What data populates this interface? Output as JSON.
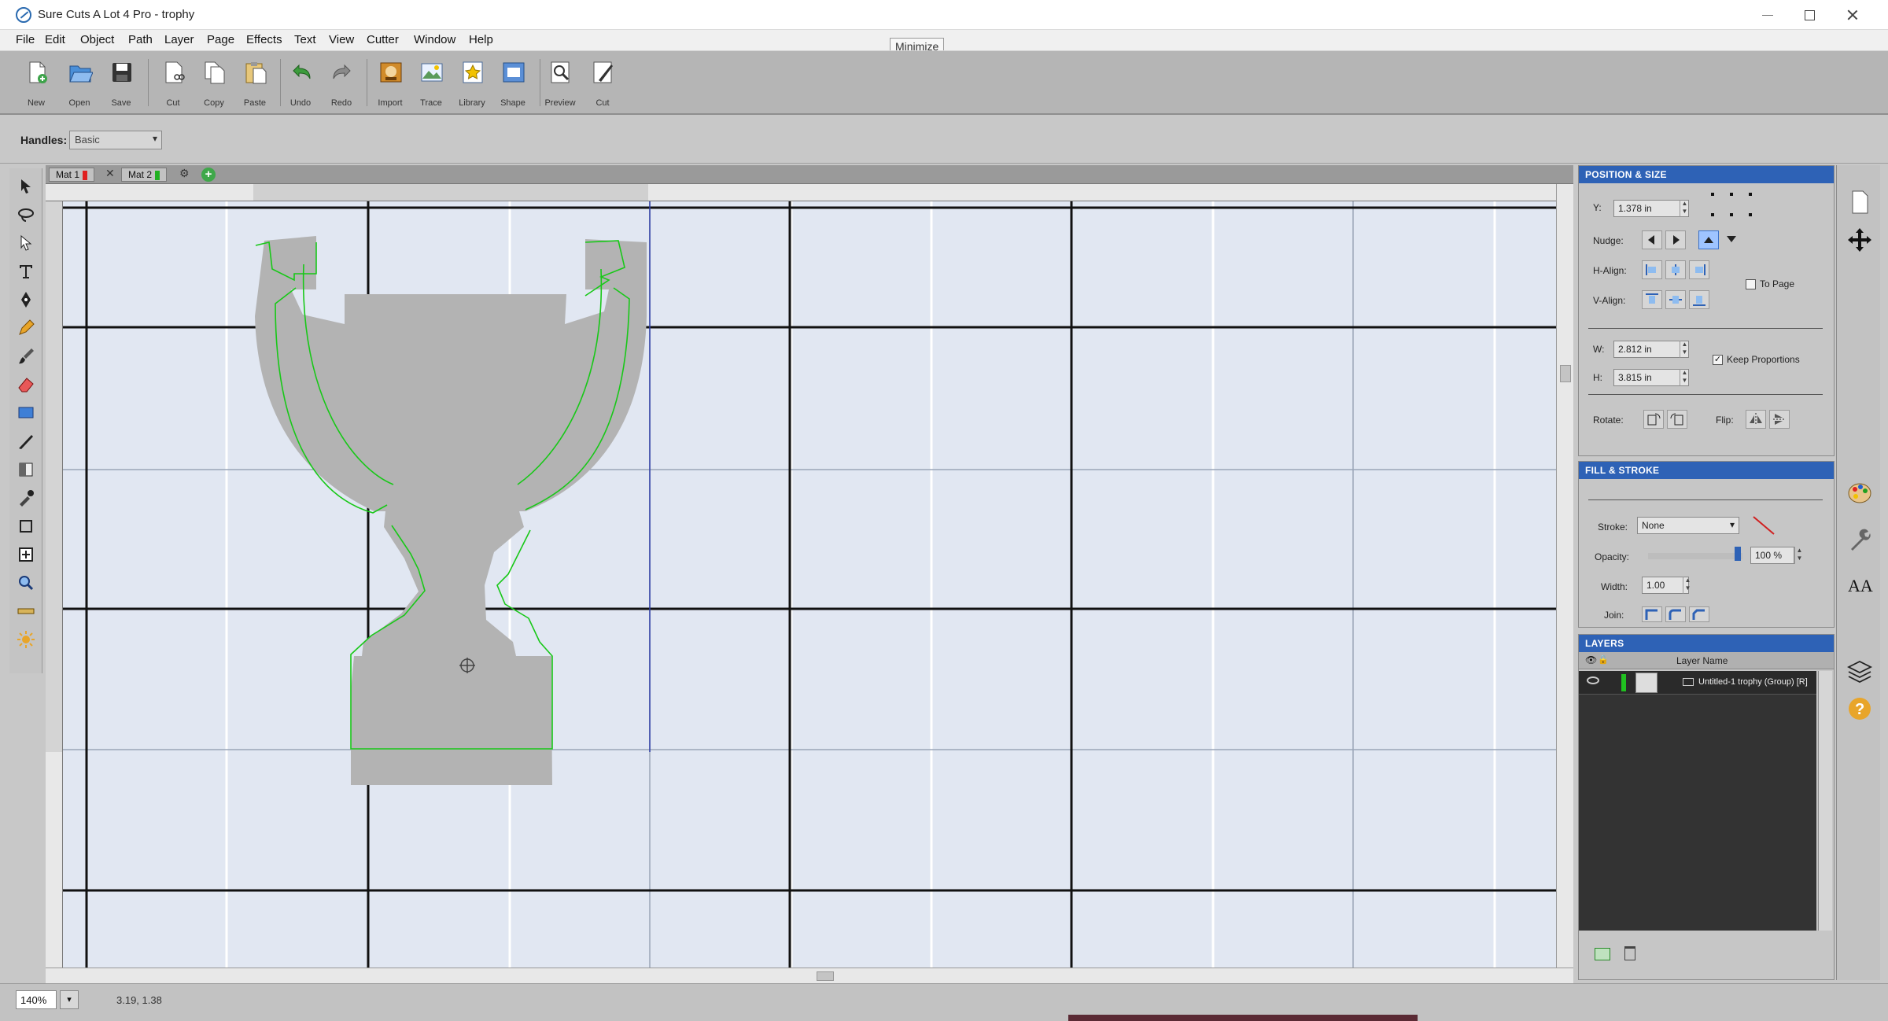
{
  "window": {
    "title": "Sure Cuts A Lot 4 Pro - trophy"
  },
  "menu": [
    "File",
    "Edit",
    "Object",
    "Path",
    "Layer",
    "Page",
    "Effects",
    "Text",
    "View",
    "Cutter",
    "Window",
    "Help"
  ],
  "tooltip": "Minimize",
  "toolbar": {
    "buttons": [
      {
        "label": "New",
        "icon": "new-document-icon",
        "color": "#ffffff"
      },
      {
        "label": "Open",
        "icon": "open-folder-icon",
        "color": "#4a8fd8"
      },
      {
        "label": "Save",
        "icon": "save-disk-icon",
        "color": "#3a3a3a"
      },
      {
        "label": "Cut",
        "icon": "scissors-icon",
        "color": "#ffffff"
      },
      {
        "label": "Copy",
        "icon": "copy-icon",
        "color": "#ffffff"
      },
      {
        "label": "Paste",
        "icon": "paste-icon",
        "color": "#e7c77a"
      },
      {
        "label": "Undo",
        "icon": "undo-icon",
        "color": "#3d9c3d"
      },
      {
        "label": "Redo",
        "icon": "redo-icon",
        "color": "#8a8a8a"
      },
      {
        "label": "Import",
        "icon": "import-icon",
        "color": "#d18b2a"
      },
      {
        "label": "Trace",
        "icon": "trace-image-icon",
        "color": "#5a9a5a"
      },
      {
        "label": "Library",
        "icon": "library-star-icon",
        "color": "#f2c200"
      },
      {
        "label": "Shape",
        "icon": "shape-library-icon",
        "color": "#5b8fd6"
      },
      {
        "label": "Preview",
        "icon": "preview-magnifier-icon",
        "color": "#ffffff"
      },
      {
        "label": "Cut",
        "icon": "cut-knife-icon",
        "color": "#ffffff"
      }
    ]
  },
  "handlebar": {
    "label": "Handles:",
    "value": "Basic"
  },
  "tools": [
    "select-arrow-icon",
    "lasso-icon",
    "node-edit-icon",
    "text-tool-icon",
    "pen-icon",
    "pencil-icon",
    "brush-icon",
    "eraser-icon",
    "rectangle-tool-icon",
    "knife-icon",
    "gradient-icon",
    "eyedropper-icon",
    "crop-icon",
    "weld-icon",
    "zoom-tool-icon",
    "ruler-tool-icon",
    "sun-icon"
  ],
  "doc_tabs": [
    {
      "label": "Mat 1",
      "color": "#e02020"
    },
    {
      "label": "Mat 2",
      "color": "#20b020"
    }
  ],
  "statusbar": {
    "zoom": "140%",
    "coords": "3.19, 1.38"
  },
  "position_panel": {
    "title": "POSITION & SIZE",
    "x_label": "Y:",
    "x_value": "1.378 in",
    "nudge_label": "Nudge:",
    "halign_label": "H-Align:",
    "valign_label": "V-Align:",
    "to_page_label": "To Page",
    "w_label": "W:",
    "w_value": "2.812 in",
    "h_label": "H:",
    "h_value": "3.815 in",
    "keep_prop_label": "Keep Proportions",
    "rotate_label": "Rotate:",
    "flip_label": "Flip:"
  },
  "fill_panel": {
    "title": "FILL & STROKE",
    "stroke_label": "Stroke:",
    "stroke_value": "None",
    "opacity_label": "Opacity:",
    "opacity_value": "100 %",
    "width_label": "Width:",
    "width_value": "1.00",
    "join_label": "Join:"
  },
  "layers_panel": {
    "title": "LAYERS",
    "column": "Layer Name",
    "layer_name": "Untitled-1 trophy (Group) [R]"
  }
}
